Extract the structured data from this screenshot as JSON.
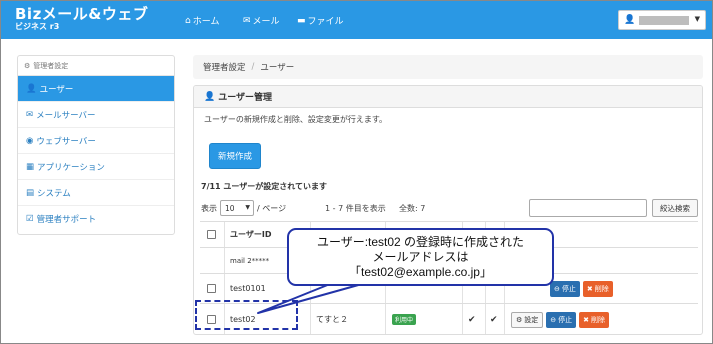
{
  "navbar": {
    "logo_main": "Bizメール&ウェブ",
    "logo_sub": "ビジネス r3",
    "items": [
      {
        "label": "ホーム",
        "icon": "home-icon"
      },
      {
        "label": "メール",
        "icon": "mail-icon"
      },
      {
        "label": "ファイル",
        "icon": "folder-icon"
      }
    ],
    "user_icon": "user-icon"
  },
  "sidebar": {
    "header": "管理者設定",
    "items": [
      {
        "label": "ユーザー",
        "icon": "user-icon",
        "active": true
      },
      {
        "label": "メールサーバー",
        "icon": "mail-icon"
      },
      {
        "label": "ウェブサーバー",
        "icon": "globe-icon"
      },
      {
        "label": "アプリケーション",
        "icon": "grid-icon"
      },
      {
        "label": "システム",
        "icon": "server-icon"
      },
      {
        "label": "管理者サポート",
        "icon": "support-icon"
      }
    ]
  },
  "breadcrumb": {
    "root": "管理者設定",
    "sep": "/",
    "current": "ユーザー"
  },
  "panel": {
    "title": "ユーザー管理",
    "description": "ユーザーの新規作成と削除、設定変更が行えます。",
    "new_button": "新規作成",
    "count_text": "7/11 ユーザーが設定されています",
    "show_label": "表示",
    "page_size": "10",
    "per_page": "/ ページ",
    "range_text": "1 - 7 件目を表示",
    "total_text": "全数: 7",
    "search_button": "絞込検索"
  },
  "table": {
    "header_userid": "ユーザーID",
    "rows": [
      {
        "userid": "mail 2*****",
        "name": "",
        "status": "",
        "checkbox": false
      },
      {
        "userid": "test0101",
        "name": "",
        "status": "",
        "checkbox": true
      },
      {
        "userid": "test02",
        "name": "てすと２",
        "status": "利用中",
        "checkbox": true,
        "tick1": "✔",
        "tick2": "✔",
        "set": "設定",
        "stop": "停止",
        "del": "削除"
      }
    ],
    "row1_stop": "停止",
    "row1_del": "削除"
  },
  "callout": {
    "line1": "ユーザー:test02 の登録時に作成された",
    "line2": "メールアドレスは",
    "line3": "「test02@example.co.jp」"
  },
  "colors": {
    "primary": "#2a98e4",
    "callout_border": "#2233a8",
    "danger": "#e8602a",
    "stop": "#2a6fb0",
    "status": "#3aa34f"
  }
}
